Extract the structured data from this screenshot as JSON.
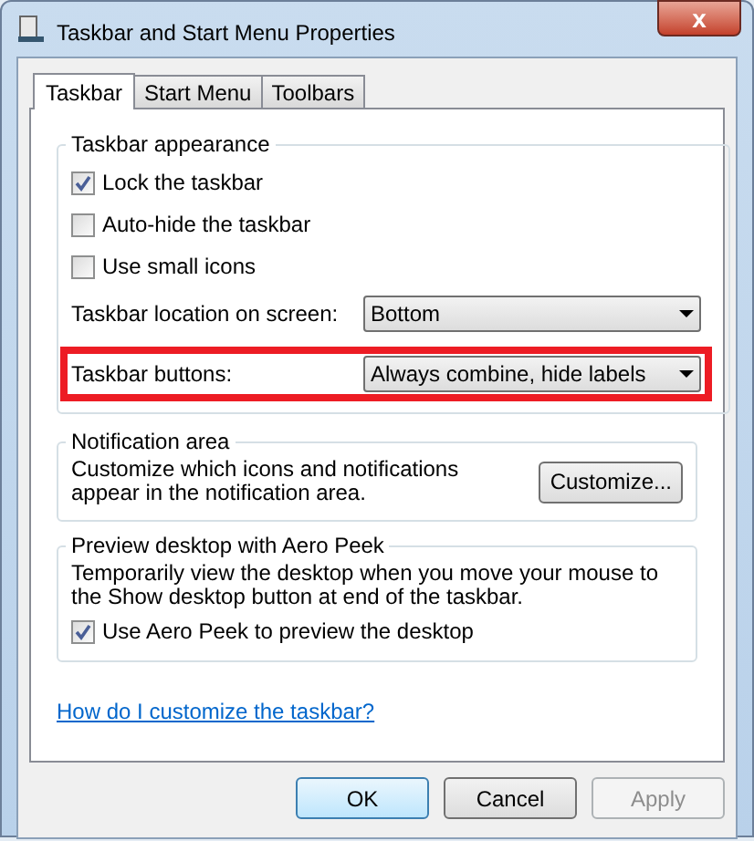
{
  "window": {
    "title": "Taskbar and Start Menu Properties",
    "close": "x"
  },
  "tabs": [
    {
      "label": "Taskbar",
      "selected": true
    },
    {
      "label": "Start Menu",
      "selected": false
    },
    {
      "label": "Toolbars",
      "selected": false
    }
  ],
  "appearance": {
    "title": "Taskbar appearance",
    "checkboxes": [
      {
        "label": "Lock the taskbar",
        "checked": true
      },
      {
        "label": "Auto-hide the taskbar",
        "checked": false
      },
      {
        "label": "Use small icons",
        "checked": false
      }
    ],
    "dropdowns": [
      {
        "label": "Taskbar location on screen:",
        "value": "Bottom",
        "highlighted": false
      },
      {
        "label": "Taskbar buttons:",
        "value": "Always combine, hide labels",
        "highlighted": true
      }
    ]
  },
  "notification": {
    "title": "Notification area",
    "text": "Customize which icons and notifications appear in the notification area.",
    "button": "Customize..."
  },
  "peek": {
    "title": "Preview desktop with Aero Peek",
    "text": "Temporarily view the desktop when you move your mouse to the Show desktop button at end of the taskbar.",
    "checkbox": {
      "label": "Use Aero Peek to preview the desktop",
      "checked": true
    }
  },
  "help_link": "How do I customize the taskbar?",
  "buttons": [
    {
      "label": "OK",
      "kind": "default",
      "disabled": false
    },
    {
      "label": "Cancel",
      "kind": "normal",
      "disabled": false
    },
    {
      "label": "Apply",
      "kind": "normal",
      "disabled": true
    }
  ]
}
